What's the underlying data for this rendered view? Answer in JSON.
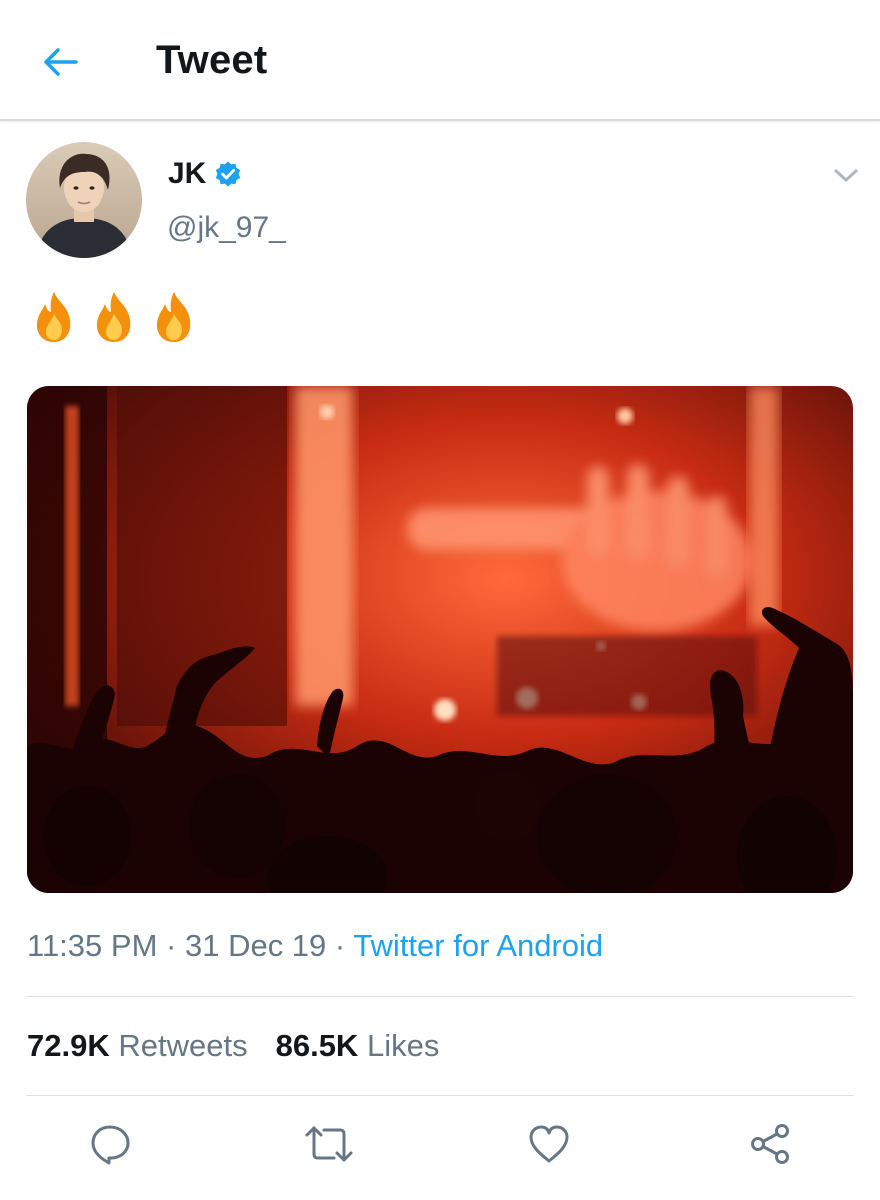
{
  "header": {
    "title": "Tweet",
    "back_icon": "arrow-left-icon",
    "accent_color": "#1da1f2"
  },
  "tweet": {
    "author": {
      "display_name": "JK",
      "handle": "@jk_97_",
      "verified": true,
      "verified_icon": "verified-badge-icon"
    },
    "text": "🔥🔥🔥",
    "media": {
      "kind": "photo",
      "description_icon": "concert-photo"
    },
    "time": "11:35 PM",
    "separator": "·",
    "date": "31 Dec 19",
    "source": "Twitter for Android",
    "stats": {
      "retweets_count": "72.9K",
      "retweets_label": "Retweets",
      "likes_count": "86.5K",
      "likes_label": "Likes"
    }
  },
  "actions": [
    "reply-icon",
    "retweet-icon",
    "like-icon",
    "share-icon"
  ],
  "colors": {
    "link": "#1da1f2",
    "secondary_text": "#657786",
    "primary_text": "#14171a",
    "divider": "#d9dee2"
  }
}
